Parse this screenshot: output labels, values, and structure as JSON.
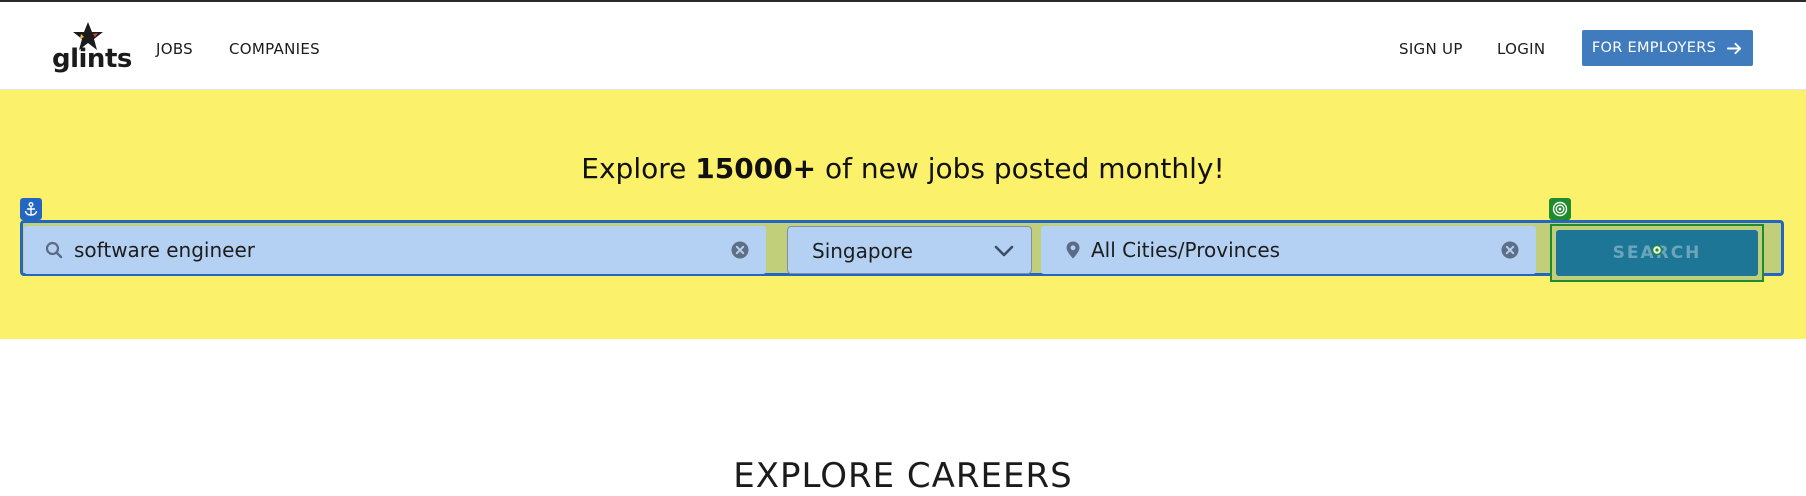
{
  "brand": {
    "logo_text": "glints",
    "logo_icon": "star-icon"
  },
  "nav": {
    "jobs": "JOBS",
    "companies": "COMPANIES",
    "sign_up": "SIGN UP",
    "login": "LOGIN",
    "for_employers": "FOR EMPLOYERS"
  },
  "hero": {
    "title_prefix": "Explore ",
    "title_highlight": "15000+",
    "title_suffix": " of new jobs posted monthly!"
  },
  "search": {
    "keyword_value": "software engineer",
    "country_value": "Singapore",
    "city_value": "All Cities/Provinces",
    "button_label": "SEARCH"
  },
  "section": {
    "explore_title": "EXPLORE CAREERS"
  },
  "colors": {
    "brand_blue": "#3f7bbd",
    "hero_yellow": "#fcf16a",
    "search_button": "#1e7697",
    "field_highlight": "#b4d1f3"
  },
  "icons": {
    "search": "search-icon",
    "clear": "close-circle-icon",
    "location": "location-pin-icon",
    "chevron": "chevron-down-icon",
    "arrow": "arrow-right-icon",
    "anchor": "anchor-icon",
    "target": "target-icon"
  }
}
